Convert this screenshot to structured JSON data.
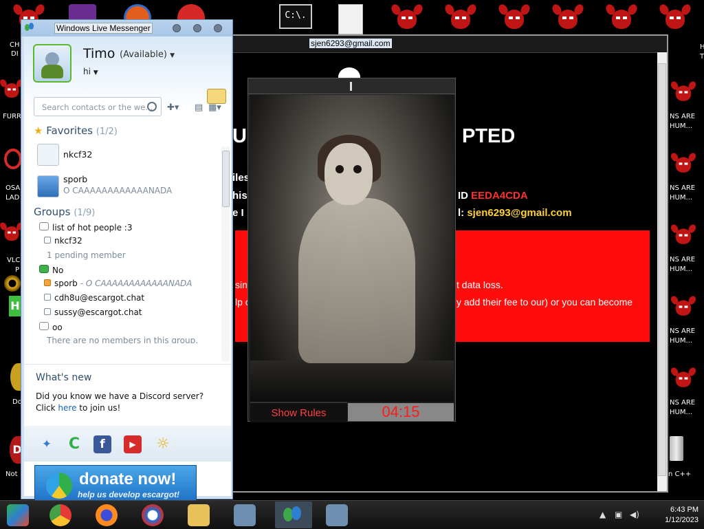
{
  "desktop": {
    "top_icon_labels": [
      "C:\\."
    ],
    "left_labels": [
      "CH",
      "DI",
      "FURR",
      "OSA",
      "LAD",
      "VLC",
      "P",
      "Do",
      "D",
      "Not"
    ],
    "right_labels": [
      "NS ARE",
      "HUM...",
      "H",
      "T",
      "n C++"
    ],
    "colors": {
      "devil": "#c01515",
      "background": "#000000"
    }
  },
  "messenger": {
    "window_title": "Windows Live Messenger",
    "user": {
      "name": "Timo",
      "status": "(Available)",
      "personal_message": "hi"
    },
    "search_placeholder": "Search contacts or the we...",
    "favorites": {
      "title": "Favorites",
      "count": "(1/2)",
      "contacts": [
        {
          "name": "nkcf32",
          "sub": ""
        },
        {
          "name": "sporb",
          "sub": "O CAAAAAAAAAAAANADA"
        }
      ]
    },
    "groups": {
      "title": "Groups",
      "count": "(1/9)",
      "rows": [
        {
          "kind": "group",
          "label": "list of hot people :3"
        },
        {
          "kind": "contact",
          "label": "nkcf32"
        },
        {
          "kind": "note",
          "label": "1 pending member"
        },
        {
          "kind": "group-online",
          "label": "No"
        },
        {
          "kind": "contact-away",
          "label": "sporb",
          "sub": " - O CAAAAAAAAAAAANADA"
        },
        {
          "kind": "contact",
          "label": "cdh8u@escargot.chat"
        },
        {
          "kind": "contact",
          "label": "sussy@escargot.chat"
        },
        {
          "kind": "group",
          "label": "oo"
        },
        {
          "kind": "note",
          "label": "There are no members in this group."
        }
      ]
    },
    "whats_new": {
      "title": "What's new",
      "text_before": "Did you know we have a Discord server? Click",
      "link": "here",
      "text_after": "to join us!"
    },
    "donate": {
      "big": "donate now!",
      "small": "help us develop escargot!"
    },
    "app_icons": [
      "msn-butterfly-icon",
      "escargot-icon",
      "facebook-icon",
      "youtube-icon",
      "sun-icon"
    ],
    "colors": {
      "accent": "#2f4e6d",
      "link": "#1660c4",
      "available": "#5bb82d"
    }
  },
  "ransom": {
    "title_email": "sjen6293@gmail.com",
    "heading_left": "UR",
    "heading_right": "PTED",
    "line1_left": "iles",
    "line2_left": "his",
    "line2_right_label": "ID",
    "line2_right_value": "EEDA4CDA",
    "line3_left": "e I",
    "line3_right_label": "l:",
    "line3_right_value": "sjen6293@gmail.com",
    "box_line1_left": "sing",
    "box_line1_right": "t data loss.",
    "box_line2_left": "lp c",
    "box_line2_right": "y add their fee to our) or you can become",
    "colors": {
      "box": "#ff0d0d",
      "id": "#ff3030",
      "email": "#ffd23a"
    }
  },
  "doll_popup": {
    "button": "Show Rules",
    "timer": "04:15"
  },
  "taskbar": {
    "time": "6:43 PM",
    "date": "1/12/2023"
  }
}
